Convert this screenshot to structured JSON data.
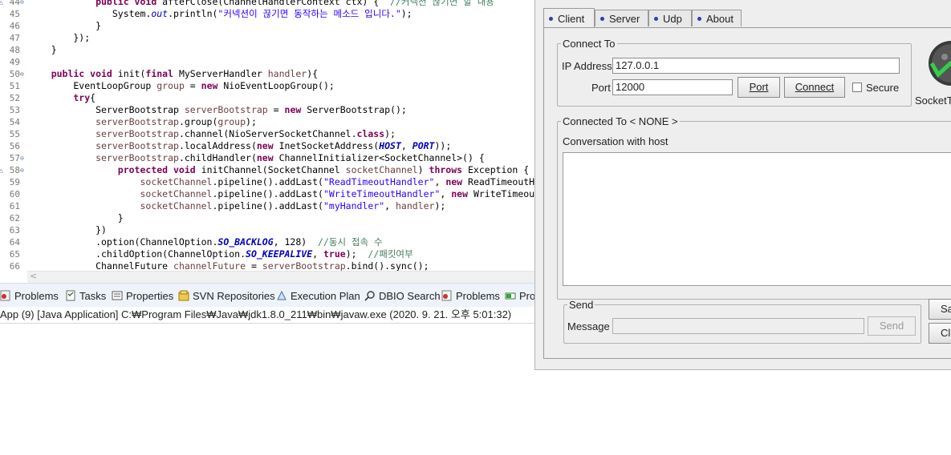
{
  "editor": {
    "lines": [
      {
        "n": "44",
        "fold": "⊖",
        "left_marker": "△",
        "segs": [
          [
            "kw",
            "            public void "
          ],
          [
            "",
            "afterClose(ChannelHandlerContext ctx) {  "
          ],
          [
            "cmt",
            "//커넥션 끊기면 할 내용"
          ]
        ]
      },
      {
        "n": "45",
        "segs": [
          [
            "",
            "               System."
          ],
          [
            "fld",
            "out"
          ],
          [
            "",
            ".println("
          ],
          [
            "str",
            "\"커넥션이 끊기면 동작하는 메소드 입니다.\""
          ],
          [
            "",
            ");"
          ]
        ]
      },
      {
        "n": "46",
        "segs": [
          [
            "",
            "            }"
          ]
        ]
      },
      {
        "n": "47",
        "segs": [
          [
            "",
            "        });"
          ]
        ]
      },
      {
        "n": "48",
        "segs": [
          [
            "",
            "    }"
          ]
        ]
      },
      {
        "n": "49",
        "segs": [
          [
            "",
            ""
          ]
        ]
      },
      {
        "n": "50",
        "fold": "⊖",
        "segs": [
          [
            "kw",
            "    public void "
          ],
          [
            "",
            "init("
          ],
          [
            "kw",
            "final "
          ],
          [
            "",
            "MyServerHandler "
          ],
          [
            "var",
            "handler"
          ],
          [
            "",
            "){"
          ]
        ]
      },
      {
        "n": "51",
        "segs": [
          [
            "",
            "        EventLoopGroup "
          ],
          [
            "var",
            "group"
          ],
          [
            "",
            " = "
          ],
          [
            "kw",
            "new "
          ],
          [
            "",
            "NioEventLoopGroup();"
          ]
        ]
      },
      {
        "n": "52",
        "segs": [
          [
            "kw",
            "        try"
          ],
          [
            "",
            "{"
          ]
        ]
      },
      {
        "n": "53",
        "segs": [
          [
            "",
            "            ServerBootstrap "
          ],
          [
            "var",
            "serverBootstrap"
          ],
          [
            "",
            " = "
          ],
          [
            "kw",
            "new "
          ],
          [
            "",
            "ServerBootstrap();"
          ]
        ]
      },
      {
        "n": "54",
        "segs": [
          [
            "var",
            "            serverBootstrap"
          ],
          [
            "",
            ".group("
          ],
          [
            "var",
            "group"
          ],
          [
            "",
            ");"
          ]
        ]
      },
      {
        "n": "55",
        "segs": [
          [
            "var",
            "            serverBootstrap"
          ],
          [
            "",
            ".channel(NioServerSocketChannel."
          ],
          [
            "kw",
            "class"
          ],
          [
            "",
            ");"
          ]
        ]
      },
      {
        "n": "56",
        "segs": [
          [
            "var",
            "            serverBootstrap"
          ],
          [
            "",
            ".localAddress("
          ],
          [
            "kw",
            "new "
          ],
          [
            "",
            "InetSocketAddress("
          ],
          [
            "cst",
            "HOST"
          ],
          [
            "",
            ", "
          ],
          [
            "cst",
            "PORT"
          ],
          [
            "",
            "));"
          ]
        ]
      },
      {
        "n": "57",
        "fold": "⊖",
        "segs": [
          [
            "var",
            "            serverBootstrap"
          ],
          [
            "",
            ".childHandler("
          ],
          [
            "kw",
            "new "
          ],
          [
            "",
            "ChannelInitializer<SocketChannel>() {"
          ]
        ]
      },
      {
        "n": "58",
        "fold": "⊖",
        "left_marker": "△",
        "segs": [
          [
            "kw",
            "                protected void "
          ],
          [
            "",
            "initChannel(SocketChannel "
          ],
          [
            "var",
            "socketChannel"
          ],
          [
            "",
            ") "
          ],
          [
            "kw",
            "throws "
          ],
          [
            "",
            "Exception {"
          ]
        ]
      },
      {
        "n": "59",
        "segs": [
          [
            "var",
            "                    socketChannel"
          ],
          [
            "",
            ".pipeline().addLast("
          ],
          [
            "str",
            "\"ReadTimeoutHandler\""
          ],
          [
            "",
            ", "
          ],
          [
            "kw",
            "new "
          ],
          [
            "",
            "ReadTimeoutH"
          ]
        ]
      },
      {
        "n": "60",
        "segs": [
          [
            "var",
            "                    socketChannel"
          ],
          [
            "",
            ".pipeline().addLast("
          ],
          [
            "str",
            "\"WriteTimeoutHandler\""
          ],
          [
            "",
            ", "
          ],
          [
            "kw",
            "new "
          ],
          [
            "",
            "WriteTimeou"
          ]
        ]
      },
      {
        "n": "61",
        "segs": [
          [
            "var",
            "                    socketChannel"
          ],
          [
            "",
            ".pipeline().addLast("
          ],
          [
            "str",
            "\"myHandler\""
          ],
          [
            "",
            ", "
          ],
          [
            "var",
            "handler"
          ],
          [
            "",
            ");"
          ]
        ]
      },
      {
        "n": "62",
        "segs": [
          [
            "",
            "                }"
          ]
        ]
      },
      {
        "n": "63",
        "segs": [
          [
            "",
            "            })"
          ]
        ]
      },
      {
        "n": "64",
        "segs": [
          [
            "",
            "            .option(ChannelOption."
          ],
          [
            "cst",
            "SO_BACKLOG"
          ],
          [
            "",
            ", 128)  "
          ],
          [
            "cmt",
            "//동시 접속 수"
          ]
        ]
      },
      {
        "n": "65",
        "segs": [
          [
            "",
            "            .childOption(ChannelOption."
          ],
          [
            "cst",
            "SO_KEEPALIVE"
          ],
          [
            "",
            ", "
          ],
          [
            "kw",
            "true"
          ],
          [
            "",
            ");  "
          ],
          [
            "cmt",
            "//패킷여부"
          ]
        ]
      },
      {
        "n": "66",
        "segs": [
          [
            "",
            "            ChannelFuture "
          ],
          [
            "var",
            "channelFuture"
          ],
          [
            "",
            " = "
          ],
          [
            "var",
            "serverBootstrap"
          ],
          [
            "",
            ".bind().sync();"
          ]
        ]
      }
    ]
  },
  "views": {
    "tabs": [
      {
        "name": "problems",
        "label": "Problems",
        "icon": "problems-icon"
      },
      {
        "name": "tasks",
        "label": "Tasks",
        "icon": "tasks-icon"
      },
      {
        "name": "properties",
        "label": "Properties",
        "icon": "properties-icon"
      },
      {
        "name": "svn-repositories",
        "label": "SVN Repositories",
        "icon": "svn-icon"
      },
      {
        "name": "execution-plan",
        "label": "Execution Plan",
        "icon": "execution-plan-icon"
      },
      {
        "name": "dbio-search",
        "label": "DBIO Search",
        "icon": "search-icon"
      },
      {
        "name": "problems-2",
        "label": "Problems",
        "icon": "problems-icon"
      },
      {
        "name": "progress",
        "label": "Pro",
        "icon": "progress-icon"
      }
    ],
    "console_text": "App (9) [Java Application] C:₩Program Files₩Java₩jdk1.8.0_211₩bin₩javaw.exe (2020. 9. 21. 오후 5:01:32)"
  },
  "sockettest": {
    "tabs": [
      {
        "label": "Client",
        "active": true
      },
      {
        "label": "Server",
        "active": false
      },
      {
        "label": "Udp",
        "active": false
      },
      {
        "label": "About",
        "active": false
      }
    ],
    "connect_group": "Connect To",
    "ip_label": "IP Address",
    "ip_value": "127.0.0.1",
    "port_label": "Port",
    "port_value": "12000",
    "port_button": "Port",
    "connect_button": "Connect",
    "secure_label": "Secure",
    "logo_text": "SocketTe",
    "connected_group": "Connected To < NONE >",
    "conversation_label": "Conversation with host",
    "send_group": "Send",
    "message_label": "Message",
    "send_button": "Send",
    "save_button": "Sa",
    "clear_button": "Cl"
  }
}
